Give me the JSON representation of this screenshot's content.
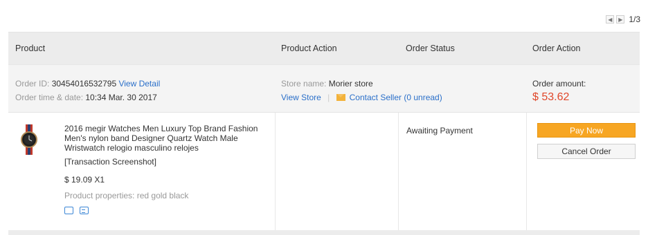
{
  "pager": {
    "text": "1/3"
  },
  "header": {
    "product": "Product",
    "product_action": "Product Action",
    "order_status": "Order Status",
    "order_action": "Order Action"
  },
  "order": {
    "id_label": "Order ID: ",
    "id_value": "30454016532795",
    "view_detail": "View Detail",
    "time_label": "Order time & date: ",
    "time_value": "10:34 Mar. 30 2017",
    "store_label": "Store name: ",
    "store_value": "Morier store",
    "view_store": "View Store",
    "separator": "|",
    "contact_seller": "Contact Seller",
    "unread": "(0 unread)",
    "amount_label": "Order amount:",
    "amount_value": "$ 53.62"
  },
  "item": {
    "title": "2016 megir Watches Men Luxury Top Brand Fashion Men's nylon band Designer Quartz Watch Male Wristwatch relogio masculino relojes",
    "snapshot": "[Transaction Screenshot]",
    "price": "$ 19.09 X1",
    "properties": "Product properties: red gold black",
    "status": "Awaiting Payment",
    "pay_now": "Pay Now",
    "cancel_order": "Cancel Order"
  },
  "colors": {
    "accent_link": "#2a6fc9",
    "amount": "#e0472a",
    "pay_button": "#f7a623"
  }
}
